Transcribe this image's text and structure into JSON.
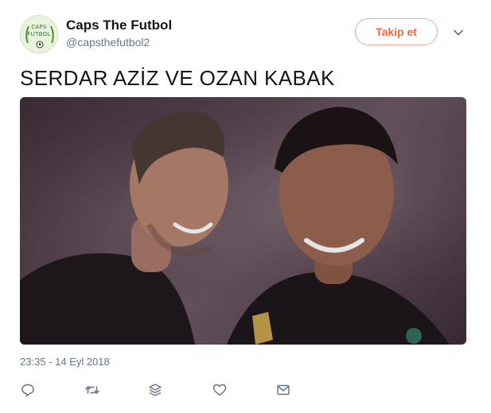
{
  "user": {
    "display_name": "Caps The Futbol",
    "screen_name": "@capsthefutbol2",
    "avatar_text_line1": "CAPS",
    "avatar_text_line2": "FUTBOL"
  },
  "follow_button_label": "Takip et",
  "tweet": {
    "text": "SERDAR AZİZ VE OZAN KABAK",
    "timestamp": "23:35 - 14 Eyl 2018"
  },
  "icons": {
    "more": "chevron-down-icon",
    "reply": "reply-icon",
    "retweet": "retweet-icon",
    "share_stack": "stack-icon",
    "like": "heart-icon",
    "message": "envelope-icon"
  },
  "colors": {
    "accent": "#ea6a3d",
    "muted": "#657786",
    "text": "#14171a"
  }
}
